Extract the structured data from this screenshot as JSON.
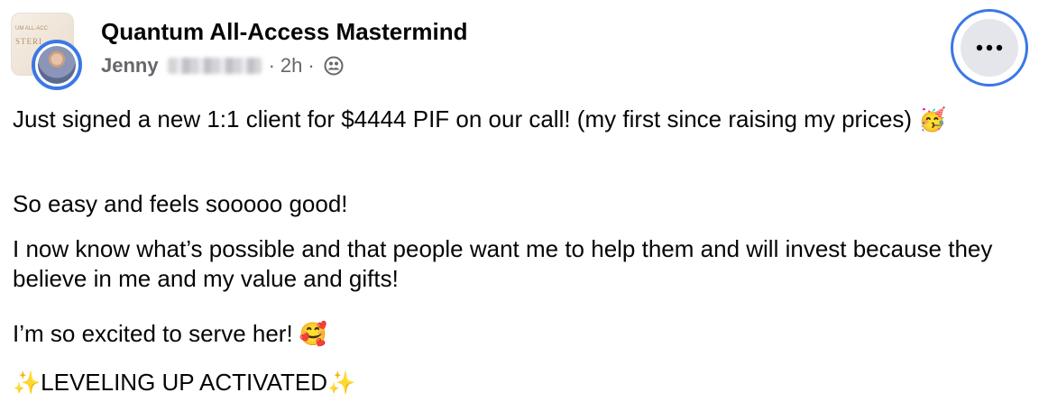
{
  "post": {
    "group_name": "Quantum All-Access Mastermind",
    "group_thumb_text": "STERI",
    "group_thumb_subtext": "UM ALL-ACC",
    "author_first_name": "Jenny",
    "timestamp": "2h",
    "separator": "·",
    "privacy_icon": "group-members-icon",
    "more_icon": "more-options-icon",
    "paragraphs": {
      "p1_text": "Just signed a new 1:1 client for $4444 PIF on our call! (my first since raising my prices) ",
      "p1_emoji": "🥳",
      "p2_text": "So easy and feels sooooo good!",
      "p3_text": "I now know what’s possible and that people want me to help them and will invest because they believe in me and my value and gifts!",
      "p4_text": "I’m so excited to serve her! ",
      "p4_emoji": "🥰",
      "p5_sparkle_left": "✨",
      "p5_text": "LEVELING UP ACTIVATED",
      "p5_sparkle_right": "✨"
    }
  },
  "colors": {
    "focus_ring": "#3a78e6",
    "secondary_text": "#65676b",
    "button_bg": "#e4e6eb"
  }
}
